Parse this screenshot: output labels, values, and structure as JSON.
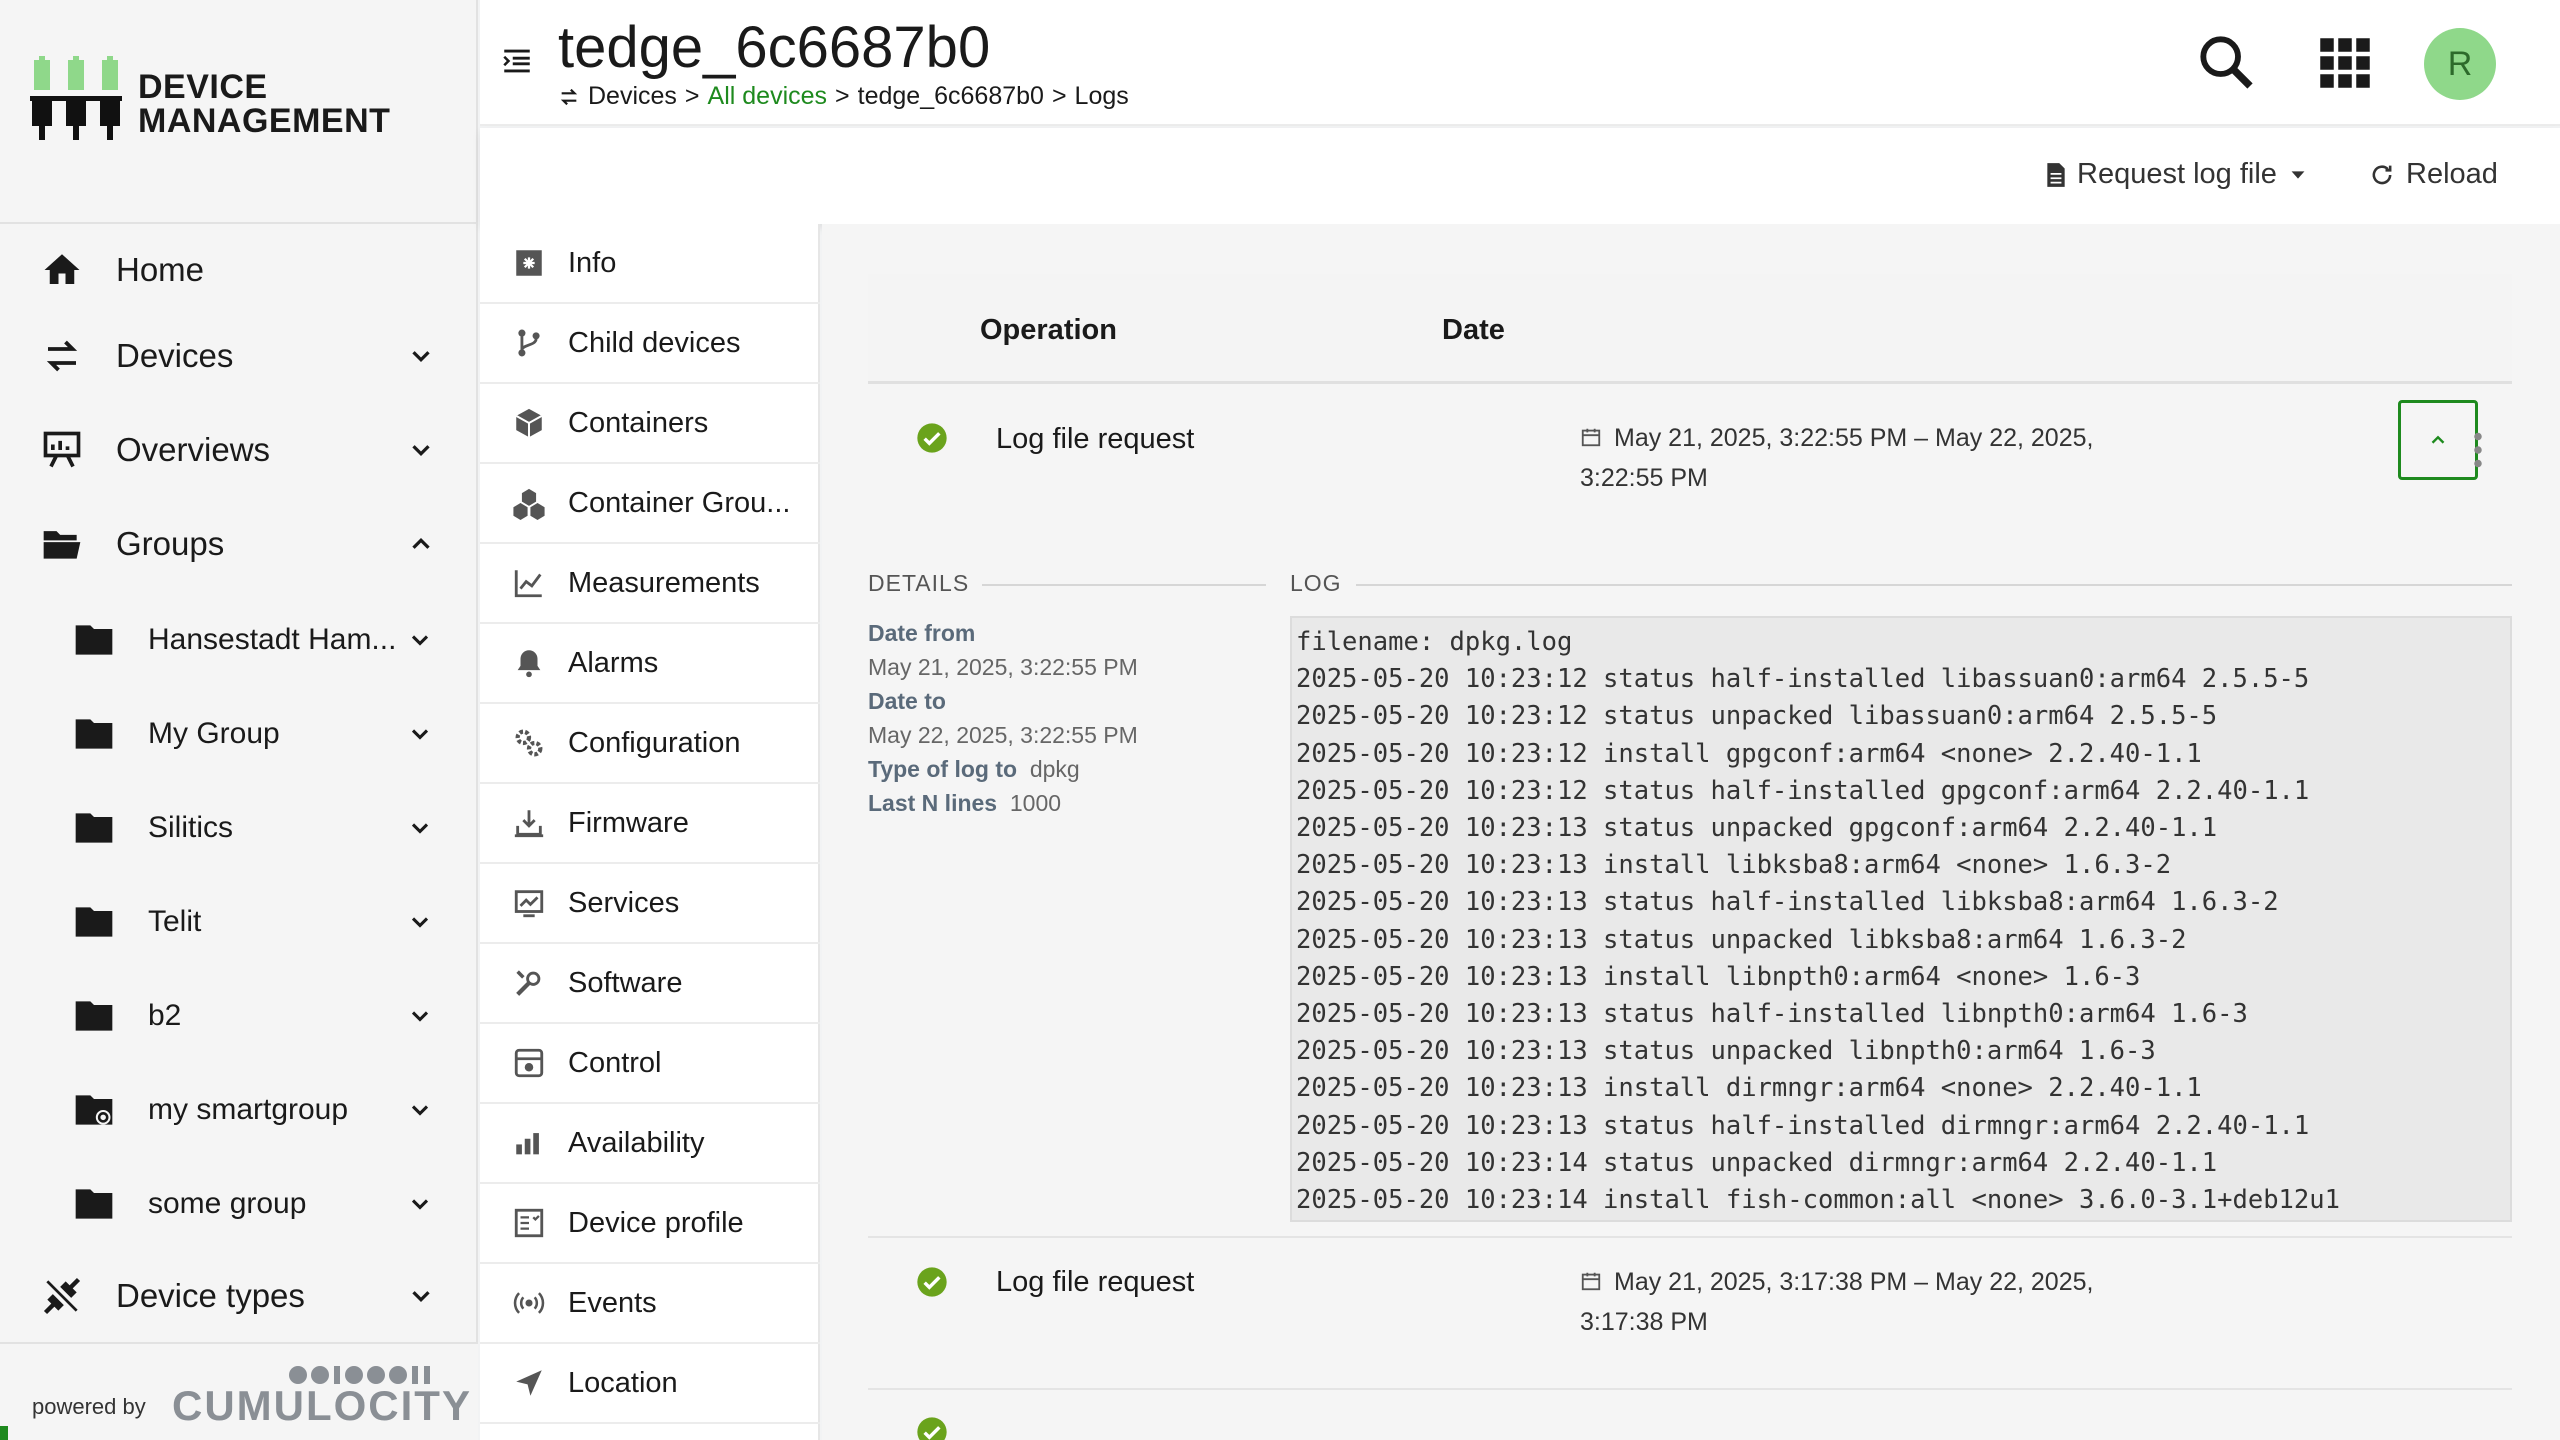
{
  "app": {
    "brand_line1": "DEVICE",
    "brand_line2": "MANAGEMENT",
    "powered_by": "powered by",
    "vendor": "CUMULOCITY"
  },
  "nav": {
    "home": "Home",
    "devices": "Devices",
    "overviews": "Overviews",
    "groups": "Groups",
    "group_items": [
      "Hansestadt Ham...",
      "My Group",
      "Silitics",
      "Telit",
      "b2",
      "my smartgroup",
      "some group"
    ],
    "device_types": "Device types"
  },
  "header": {
    "title": "tedge_6c6687b0",
    "breadcrumb": {
      "root": "Devices",
      "sep": ">",
      "all": "All devices",
      "device": "tedge_6c6687b0",
      "page": "Logs"
    },
    "avatar_initial": "R"
  },
  "actions": {
    "request_log": "Request log file",
    "reload": "Reload"
  },
  "tabs": [
    "Info",
    "Child devices",
    "Containers",
    "Container Grou...",
    "Measurements",
    "Alarms",
    "Configuration",
    "Firmware",
    "Services",
    "Software",
    "Control",
    "Availability",
    "Device profile",
    "Events",
    "Location"
  ],
  "table": {
    "col_operation": "Operation",
    "col_date": "Date",
    "rows": [
      {
        "operation": "Log file request",
        "date_line1": "May 21, 2025, 3:22:55 PM – May 22, 2025,",
        "date_line2": "3:22:55 PM",
        "status": "successful",
        "expanded": true
      },
      {
        "operation": "Log file request",
        "date_line1": "May 21, 2025, 3:17:38 PM – May 22, 2025,",
        "date_line2": "3:17:38 PM",
        "status": "successful",
        "expanded": false
      }
    ]
  },
  "details": {
    "section_label": "DETAILS",
    "date_from_label": "Date from",
    "date_from": "May 21, 2025, 3:22:55 PM",
    "date_to_label": "Date to",
    "date_to": "May 22, 2025, 3:22:55 PM",
    "type_label": "Type of log to",
    "type": "dpkg",
    "last_n_label": "Last N lines",
    "last_n": "1000"
  },
  "log": {
    "section_label": "LOG",
    "lines": [
      "filename: dpkg.log",
      "2025-05-20 10:23:12 status half-installed libassuan0:arm64 2.5.5-5",
      "2025-05-20 10:23:12 status unpacked libassuan0:arm64 2.5.5-5",
      "2025-05-20 10:23:12 install gpgconf:arm64 <none> 2.2.40-1.1",
      "2025-05-20 10:23:12 status half-installed gpgconf:arm64 2.2.40-1.1",
      "2025-05-20 10:23:13 status unpacked gpgconf:arm64 2.2.40-1.1",
      "2025-05-20 10:23:13 install libksba8:arm64 <none> 1.6.3-2",
      "2025-05-20 10:23:13 status half-installed libksba8:arm64 1.6.3-2",
      "2025-05-20 10:23:13 status unpacked libksba8:arm64 1.6.3-2",
      "2025-05-20 10:23:13 install libnpth0:arm64 <none> 1.6-3",
      "2025-05-20 10:23:13 status half-installed libnpth0:arm64 1.6-3",
      "2025-05-20 10:23:13 status unpacked libnpth0:arm64 1.6-3",
      "2025-05-20 10:23:13 install dirmngr:arm64 <none> 2.2.40-1.1",
      "2025-05-20 10:23:13 status half-installed dirmngr:arm64 2.2.40-1.1",
      "2025-05-20 10:23:14 status unpacked dirmngr:arm64 2.2.40-1.1",
      "2025-05-20 10:23:14 install fish-common:all <none> 3.6.0-3.1+deb12u1"
    ]
  },
  "colors": {
    "accent": "#1e8a1e",
    "success": "#6aa31c",
    "avatar_bg": "#8fd88a"
  }
}
